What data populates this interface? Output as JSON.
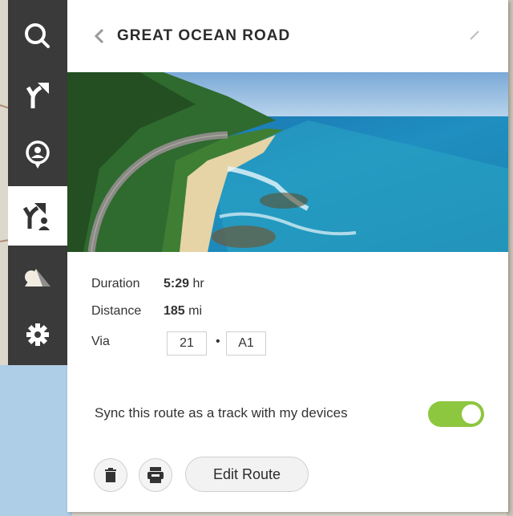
{
  "sidebar": {
    "items": [
      {
        "icon": "search-icon",
        "active": false
      },
      {
        "icon": "directions-icon",
        "active": false
      },
      {
        "icon": "location-pin-icon",
        "active": false
      },
      {
        "icon": "my-routes-icon",
        "active": true
      },
      {
        "icon": "map-layers-icon",
        "active": false
      },
      {
        "icon": "gear-icon",
        "active": false
      }
    ]
  },
  "header": {
    "title": "GREAT OCEAN ROAD",
    "back_icon": "chevron-left-icon",
    "edit_icon": "pencil-icon"
  },
  "details": {
    "duration_label": "Duration",
    "duration_value": "5:29",
    "duration_unit": "hr",
    "distance_label": "Distance",
    "distance_value": "185",
    "distance_unit": "mi",
    "via_label": "Via",
    "via_roads": [
      "21",
      "A1"
    ],
    "via_separator": "•"
  },
  "sync": {
    "label": "Sync this route as a track with my devices",
    "enabled": true
  },
  "actions": {
    "delete_icon": "trash-icon",
    "gpx_icon": "gpx-export-icon",
    "edit_route_label": "Edit Route"
  },
  "colors": {
    "toggle_on": "#8dc63f",
    "sidebar_bg": "#3a3a3a",
    "title_text": "#2b2b2b"
  }
}
